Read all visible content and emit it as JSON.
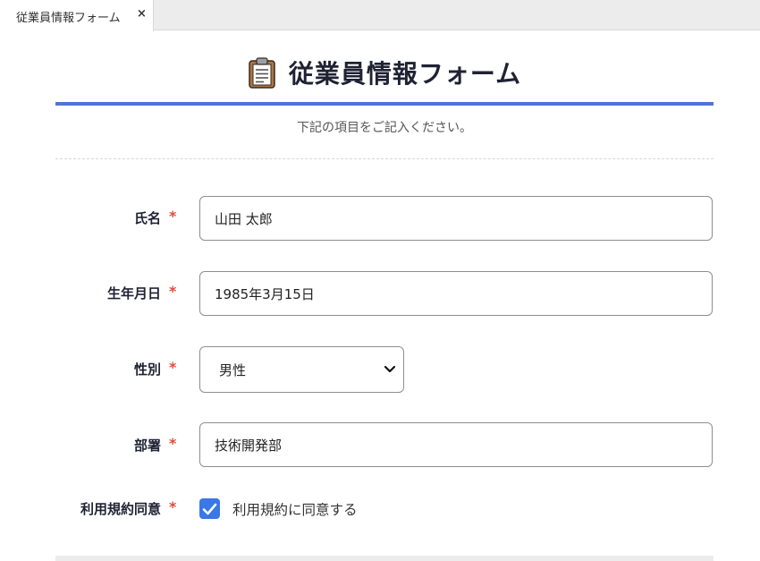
{
  "tab": {
    "title": "従業員情報フォーム",
    "close_glyph": "×"
  },
  "header": {
    "icon": "clipboard-icon",
    "title": "従業員情報フォーム",
    "subtitle": "下記の項目をご記入ください。",
    "accent_color": "#4f74d8"
  },
  "form": {
    "required_mark": "*",
    "required_color": "#e14b3b",
    "name": {
      "label": "氏名",
      "value": "山田 太郎"
    },
    "birthdate": {
      "label": "生年月日",
      "value": "1985年3月15日"
    },
    "gender": {
      "label": "性別",
      "selected": "男性",
      "icon": "chevron-down-icon"
    },
    "department": {
      "label": "部署",
      "value": "技術開発部"
    },
    "terms": {
      "label": "利用規約同意",
      "checkbox_label": "利用規約に同意する",
      "checked": true,
      "check_color": "#3a78e8"
    }
  }
}
